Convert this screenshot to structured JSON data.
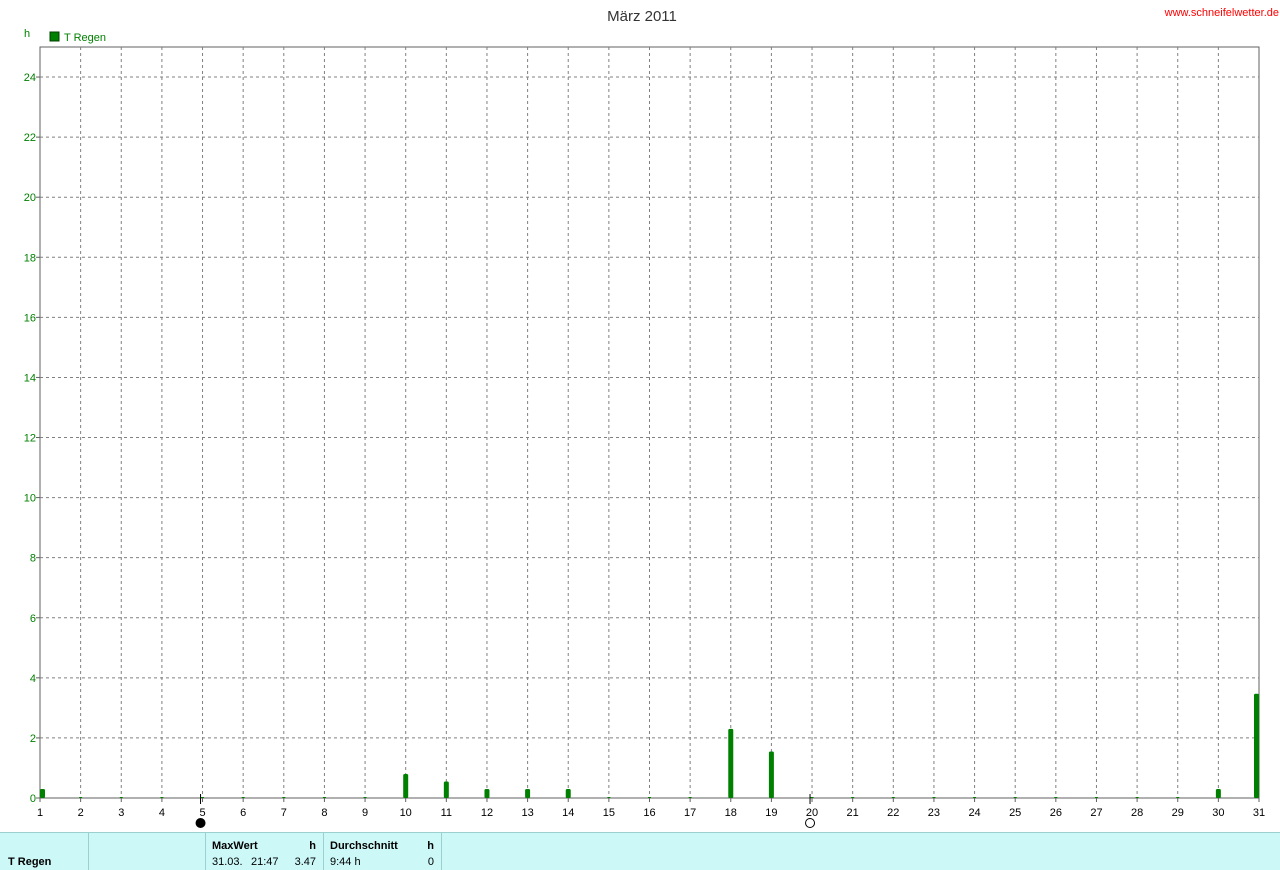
{
  "chart_data": {
    "type": "bar",
    "title": "März 2011",
    "watermark": "www.schneifelwetter.de",
    "ylabel": "h",
    "ylim": [
      0,
      25
    ],
    "yticks": [
      0,
      2,
      4,
      6,
      8,
      10,
      12,
      14,
      16,
      18,
      20,
      22,
      24
    ],
    "xlim": [
      1,
      31
    ],
    "grid": true,
    "legend_position": "top-left",
    "colors": {
      "series": "#008000",
      "title": "#333333",
      "watermark": "#ff0000",
      "axis": "#008000",
      "grid": "#808080"
    },
    "series": [
      {
        "name": "T Regen",
        "points": [
          {
            "day": 1,
            "value": 0.3
          },
          {
            "day": 10,
            "value": 0.8
          },
          {
            "day": 11,
            "value": 0.55
          },
          {
            "day": 12,
            "value": 0.3
          },
          {
            "day": 13,
            "value": 0.3
          },
          {
            "day": 14,
            "value": 0.3
          },
          {
            "day": 18,
            "value": 2.3
          },
          {
            "day": 19,
            "value": 1.55
          },
          {
            "day": 30,
            "value": 0.3
          },
          {
            "day": 31,
            "value": 3.47
          }
        ]
      }
    ],
    "moon_phases": [
      {
        "day": 5,
        "phase": "new-moon"
      },
      {
        "day": 20,
        "phase": "full-moon"
      }
    ]
  },
  "info": {
    "series_label": "T Regen",
    "max_header": "MaxWert",
    "max_unit": "h",
    "max_date": "31.03.",
    "max_time": "21:47",
    "max_value": "3.47",
    "avg_header": "Durchschnitt",
    "avg_unit": "h",
    "avg_value": "9:44 h",
    "avg_count": "0"
  }
}
